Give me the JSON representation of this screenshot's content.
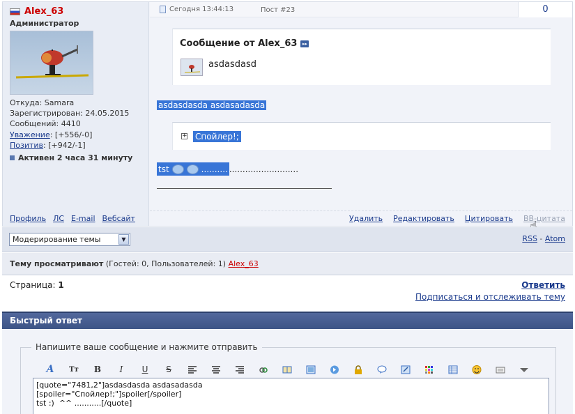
{
  "user": {
    "name": "Alex_63",
    "rank": "Администратор",
    "from": "Откуда: Samara",
    "registered": "Зарегистрирован: 24.05.2015",
    "messages": "Сообщений: 4410",
    "respect_label": "Уважение",
    "respect_value": ": [+556/-0]",
    "positive_label": "Позитив",
    "positive_value": ": [+942/-1]",
    "active": "Активен 2 часа 31 минуту",
    "links": [
      "Профиль",
      "ЛС",
      "E-mail",
      "Вебсайт"
    ]
  },
  "post": {
    "date": "Сегодня 13:44:13",
    "post_number": "Пост #23",
    "rating": "0",
    "quote_title": "Сообщение от Alex_63",
    "quote_text": "asdasdasd",
    "body_text": "asdasdasda asdasadasda",
    "spoiler_label": "Спойлер!;",
    "tst_text": "tst",
    "tst_dots_selected": "..........",
    "tst_dots_rest": "..........................",
    "actions": [
      "Удалить",
      "Редактировать",
      "Цитировать",
      "BB-цитата"
    ]
  },
  "moderation": {
    "select_value": "Модерирование темы",
    "rss": "RSS",
    "separator": "-",
    "atom": "Atom"
  },
  "viewers": {
    "label": "Тему просматривают",
    "counts": "(Гостей: 0, Пользователей: 1)",
    "user": "Alex_63"
  },
  "pagination": {
    "label": "Страница:",
    "page": "1",
    "reply": "Ответить",
    "subscribe": "Подписаться и отслеживать тему"
  },
  "quick_reply": {
    "title": "Быстрый ответ",
    "legend": "Напишите ваше сообщение и нажмите отправить",
    "toolbar": [
      "font-icon",
      "size-icon",
      "bold-icon",
      "italic-icon",
      "underline-icon",
      "strike-icon",
      "align-left-icon",
      "align-center-icon",
      "align-right-icon",
      "link-icon",
      "book-icon",
      "image-icon",
      "video-icon",
      "lock-icon",
      "speech-icon",
      "code-icon",
      "color-grid-icon",
      "table-icon",
      "smiley-icon",
      "keyboard-icon",
      "more-icon"
    ],
    "toolbar_labels": {
      "size": "Tт",
      "bold": "B",
      "italic": "I",
      "underline": "U",
      "strike": "S"
    },
    "editor_text": "[quote=\"7481,2\"]asdasdasda asdasadasda\n[spoiler=\"Спойлер!;\"]spoiler[/spoiler]\ntst :)  ^^ ...........[/quote]"
  },
  "colors": {
    "username": "#cc0000",
    "link": "#1a3a8c",
    "selection": "#3875d7",
    "header_bar": "#3d5486"
  }
}
